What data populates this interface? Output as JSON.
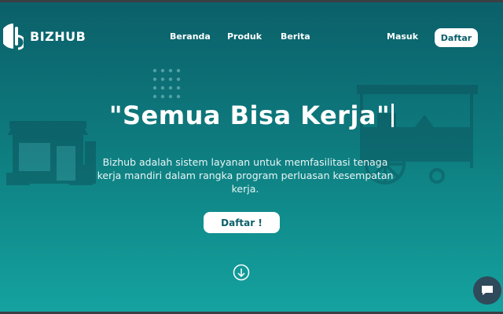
{
  "brand": {
    "name": "BIZHUB",
    "logo_icon": "bizhub-logo-icon"
  },
  "nav": {
    "items": [
      {
        "label": "Beranda"
      },
      {
        "label": "Produk"
      },
      {
        "label": "Berita"
      }
    ],
    "login_label": "Masuk",
    "register_label": "Daftar"
  },
  "hero": {
    "title": "\"Semua Bisa Kerja\"",
    "subtitle": "Bizhub adalah sistem layanan untuk memfasilitasi tenaga kerja mandiri dalam rangka program perluasan kesempatan kerja.",
    "cta_label": "Daftar !",
    "scroll_icon": "arrow-down-circle-icon"
  },
  "chat": {
    "icon": "chat-icon"
  },
  "colors": {
    "bg_top": "#0b5f69",
    "bg_bottom": "#14a3a0",
    "button_bg": "#ffffff",
    "button_text": "#0b5f69",
    "chat_bg": "#2f4a5a"
  }
}
